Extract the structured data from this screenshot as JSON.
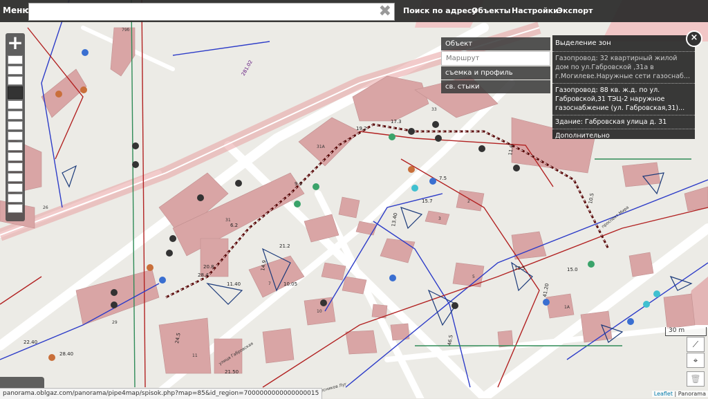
{
  "topbar": {
    "menu_label": "Меню",
    "search_placeholder": "",
    "search_clear": "✖",
    "nav": [
      "Поиск по адресу",
      "Объекты",
      "Настройки",
      "Экспорт"
    ]
  },
  "layers": [
    "Объект",
    "Маршрут",
    "съемка и профиль",
    "св. стыки"
  ],
  "info_panel": {
    "title": "Выделение зон",
    "item1": "Газопровод: 32 квартирный жилой дом по ул.Габровской ,31а в г.Могилеве.Наружные сети газоснаб...",
    "item2": "Газопровод: 88 кв. ж.д. по ул. Габровской,31 ТЭЦ-2 наружное газоснабжение (ул. Габровская,31)...",
    "item3": "Здание: Габровская улица д. 31",
    "more": "Дополнительно",
    "close": "×"
  },
  "map": {
    "streets": [
      "улица Габровская",
      "проспект Мира",
      "Лесников Луг"
    ],
    "building_numbers": [
      "79б",
      "33",
      "31А",
      "31",
      "26",
      "29",
      "7",
      "10",
      "11",
      "2",
      "5",
      "1А",
      "3"
    ],
    "measurements": [
      "281.02",
      "19.2",
      "9.3",
      "6.2",
      "7.5",
      "15.7",
      "13.40",
      "14.9",
      "21.2",
      "20.8",
      "28.4",
      "11.40",
      "10.05",
      "21.50",
      "28.40",
      "22.40",
      "24.5",
      "15.0",
      "41.20",
      "10.5",
      "17.3",
      "11.0",
      "46.5",
      "13.5"
    ]
  },
  "scale_label": "30 m",
  "status_url": "panorama.oblgaz.com/panorama/pipe4map/spisok.php?map=85&id_region=7000000000000000015",
  "attribution": {
    "leaflet": "Leaflet",
    "sep": " | ",
    "source": "Panorama"
  },
  "colors": {
    "building": "#d9a5a5",
    "road": "#ffffff",
    "pipe_red": "#b22222",
    "pipe_blue": "#2d3cc8",
    "pipe_green": "#2e8b57",
    "railway": "#e58a8a"
  }
}
